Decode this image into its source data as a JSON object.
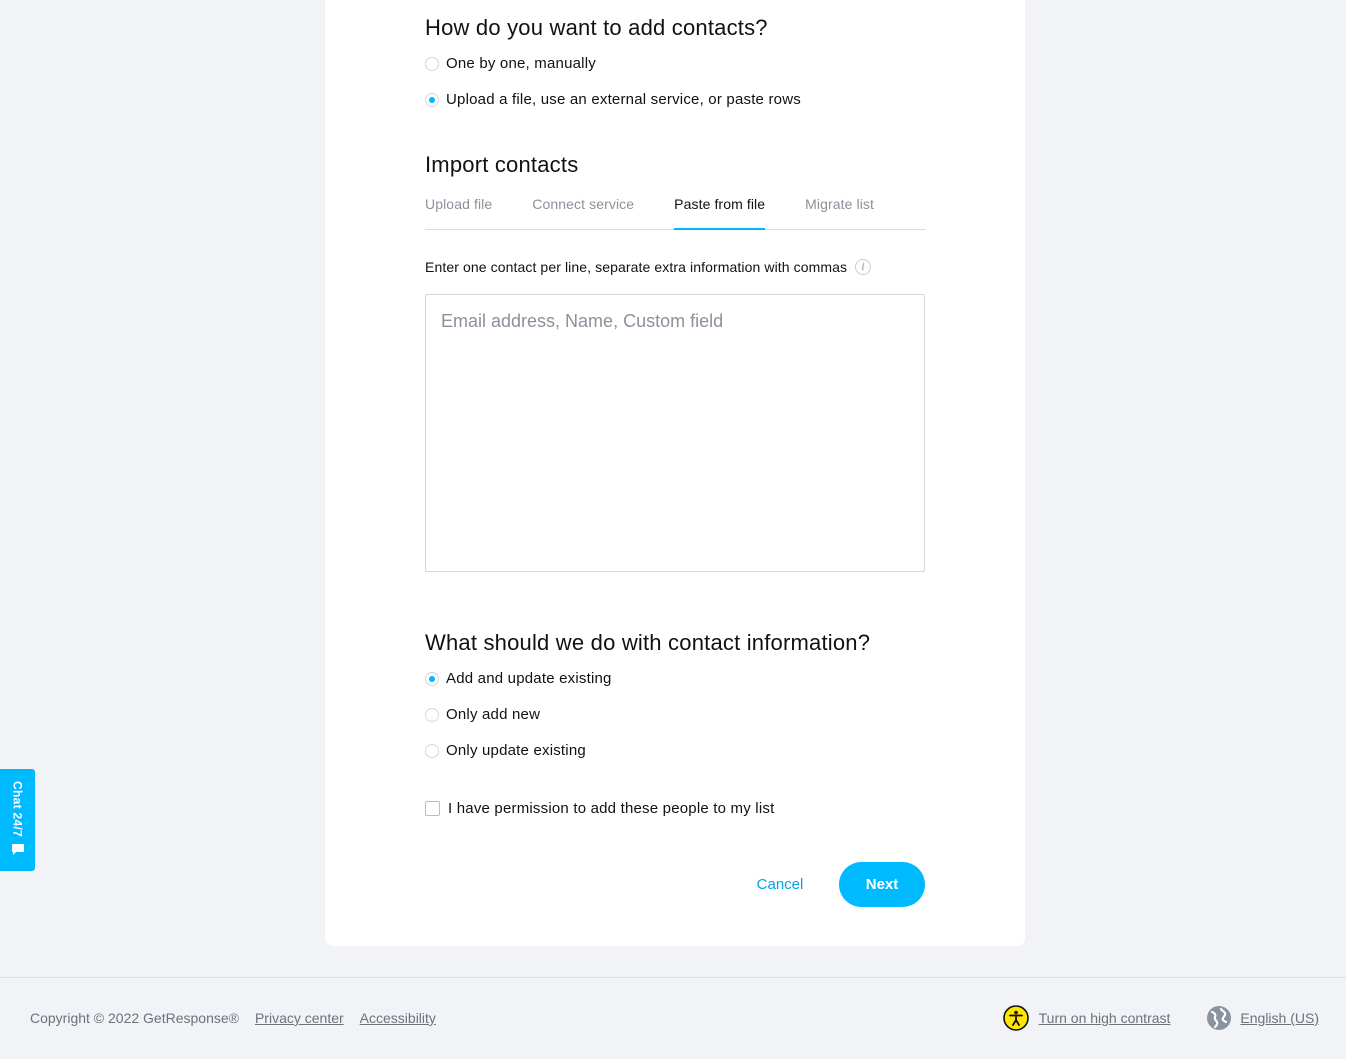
{
  "add_method": {
    "heading": "How do you want to add contacts?",
    "options": [
      {
        "label": "One by one, manually",
        "checked": false
      },
      {
        "label": "Upload a file, use an external service, or paste rows",
        "checked": true
      }
    ]
  },
  "import": {
    "heading": "Import contacts",
    "tabs": [
      {
        "label": "Upload file",
        "active": false
      },
      {
        "label": "Connect service",
        "active": false
      },
      {
        "label": "Paste from file",
        "active": true
      },
      {
        "label": "Migrate list",
        "active": false
      }
    ],
    "hint": "Enter one contact per line, separate extra information with commas",
    "textarea_placeholder": "Email address, Name, Custom field",
    "textarea_value": ""
  },
  "contact_info": {
    "heading": "What should we do with contact information?",
    "options": [
      {
        "label": "Add and update existing",
        "checked": true
      },
      {
        "label": "Only add new",
        "checked": false
      },
      {
        "label": "Only update existing",
        "checked": false
      }
    ]
  },
  "permission": {
    "label": "I have permission to add these people to my list",
    "checked": false
  },
  "actions": {
    "cancel_label": "Cancel",
    "next_label": "Next"
  },
  "chat": {
    "label": "Chat 24/7"
  },
  "footer": {
    "copyright": "Copyright © 2022 GetResponse®",
    "privacy_label": "Privacy center",
    "accessibility_label": "Accessibility",
    "contrast_label": "Turn on high contrast",
    "language_label": "English (US)"
  },
  "colors": {
    "accent": "#00baff",
    "background": "#f1f3f7",
    "card": "#ffffff"
  }
}
